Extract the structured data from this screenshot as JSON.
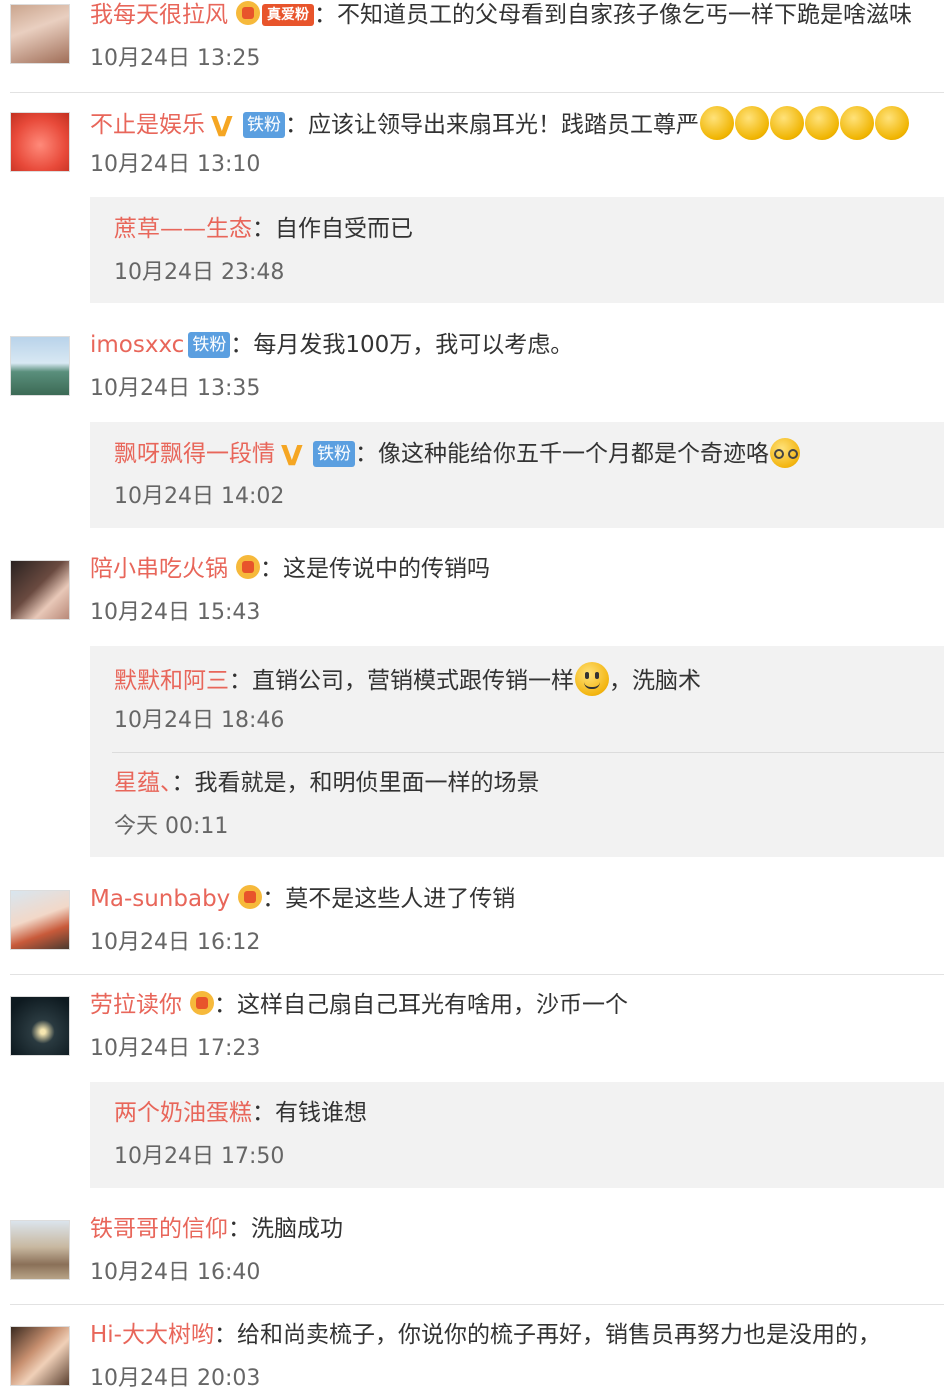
{
  "comments": [
    {
      "username": "我每天很拉风",
      "badge_tag": "真爱粉",
      "text": "不知道员工的父母看到自家孩子像乞丐一样下跪是啥滋味",
      "time": "10月24日 13:25"
    },
    {
      "username": "不止是娱乐",
      "badge_fan": "铁粉",
      "text": "应该让领导出来扇耳光！践踏员工尊严",
      "time": "10月24日 13:10",
      "replies": [
        {
          "username": "蔗草——生态",
          "text": "自作自受而已",
          "time": "10月24日 23:48"
        }
      ]
    },
    {
      "username": "imosxxc",
      "badge_fan": "铁粉",
      "text": "每月发我100万，我可以考虑。",
      "time": "10月24日 13:35",
      "replies": [
        {
          "username": "飘呀飘得一段情",
          "badge_fan": "铁粉",
          "text": "像这种能给你五千一个月都是个奇迹咯",
          "time": "10月24日 14:02"
        }
      ]
    },
    {
      "username": "陪小串吃火锅",
      "text": "这是传说中的传销吗",
      "time": "10月24日 15:43",
      "replies": [
        {
          "username": "默默和阿三",
          "text": "直销公司，营销模式跟传销一样",
          "text_after": "，洗脑术",
          "time": "10月24日 18:46"
        },
        {
          "username": "星蕴、",
          "text": "我看就是，和明侦里面一样的场景",
          "time": "今天 00:11"
        }
      ]
    },
    {
      "username": "Ma-sunbaby",
      "text": "莫不是这些人进了传销",
      "time": "10月24日 16:12"
    },
    {
      "username": "劳拉读你",
      "text": "这样自己扇自己耳光有啥用，沙币一个",
      "time": "10月24日 17:23",
      "replies": [
        {
          "username": "两个奶油蛋糕",
          "text": "有钱谁想",
          "time": "10月24日 17:50"
        }
      ]
    },
    {
      "username": "铁哥哥的信仰",
      "text": "洗脑成功",
      "time": "10月24日 16:40"
    },
    {
      "username": "Hi-大大树哟",
      "text": "给和尚卖梳子，你说你的梳子再好，销售员再努力也是没用的，",
      "time": "10月24日 20:03"
    }
  ],
  "colon": "："
}
